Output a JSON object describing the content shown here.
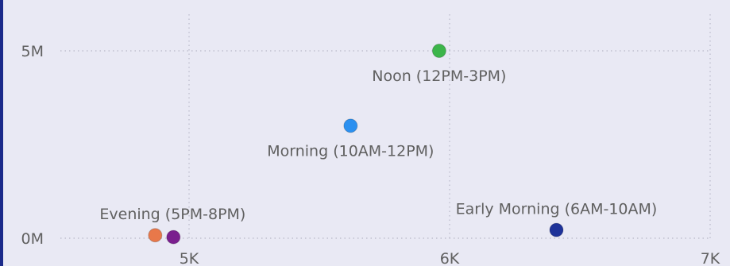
{
  "colors": {
    "background": "#e9e9f4",
    "left_border": "#1b2a8a",
    "grid": "#b8b8c8",
    "label_text": "#606060"
  },
  "chart_data": {
    "type": "scatter",
    "title": "",
    "xlabel": "",
    "ylabel": "",
    "xlim": [
      4500,
      7000
    ],
    "ylim": [
      0,
      5800000
    ],
    "x_ticks": [
      {
        "value": 5000,
        "label": "5K"
      },
      {
        "value": 6000,
        "label": "6K"
      },
      {
        "value": 7000,
        "label": "7K"
      }
    ],
    "y_ticks": [
      {
        "value": 0,
        "label": "0M"
      },
      {
        "value": 5000000,
        "label": "5M"
      }
    ],
    "grid": true,
    "points": [
      {
        "label": "Noon (12PM-3PM)",
        "x": 5960,
        "y": 5000000,
        "color": "#3cb54a",
        "label_position": "below"
      },
      {
        "label": "Morning (10AM-12PM)",
        "x": 5620,
        "y": 3000000,
        "color": "#2b90f0",
        "label_position": "below"
      },
      {
        "label": "Early Morning (6AM-10AM)",
        "x": 6410,
        "y": 220000,
        "color": "#1e3299",
        "label_position": "above"
      },
      {
        "label": "Evening (5PM-8PM)",
        "x": 4870,
        "y": 80000,
        "color": "#e8784a",
        "label_position": "above"
      },
      {
        "label": "",
        "x": 4940,
        "y": 30000,
        "color": "#7a1f8e",
        "label_position": "none"
      }
    ]
  }
}
